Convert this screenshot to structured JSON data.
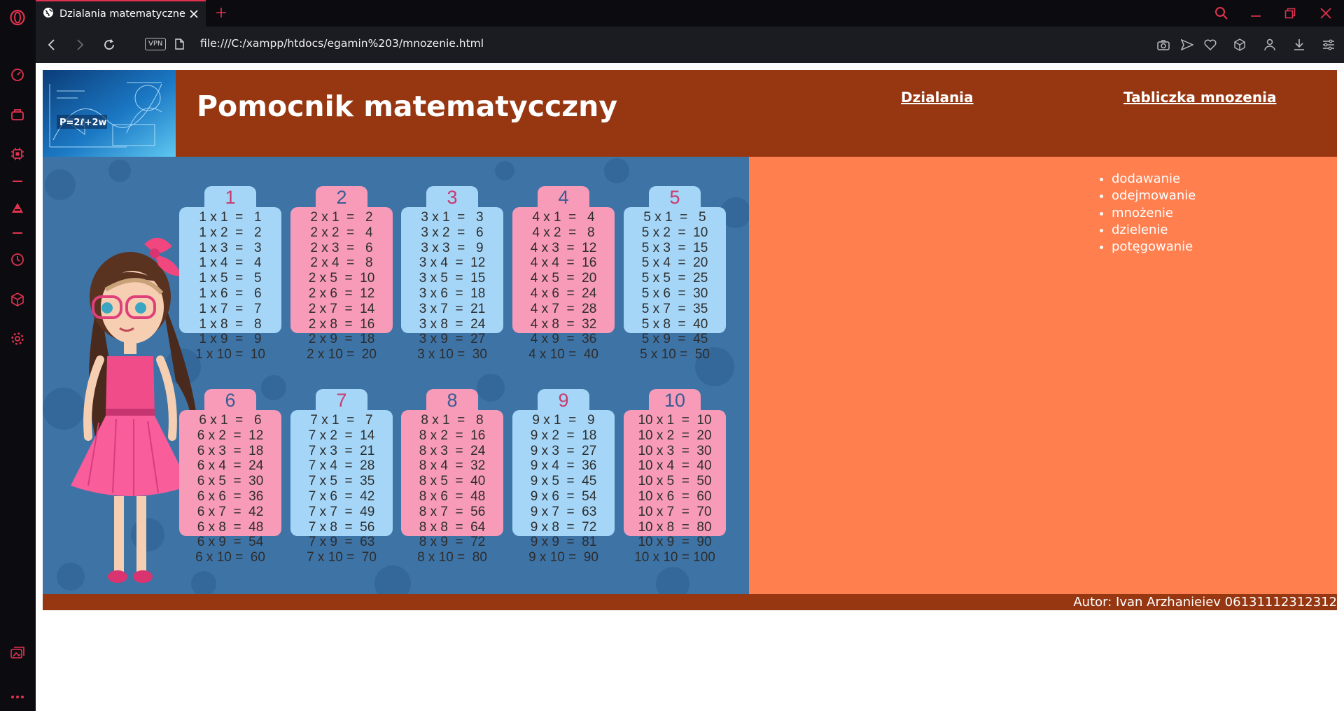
{
  "browser": {
    "tab_title": "Dzialania matematyczne",
    "vpn_label": "VPN",
    "url": "file:///C:/xampp/htdocs/egamin%203/mnozenie.html",
    "accent_color": "#e2324f"
  },
  "page": {
    "title": "Pomocnik matematycczny",
    "nav": {
      "link1": "Dzialania",
      "link2": "Tabliczka mnozenia"
    },
    "operations": [
      "dodawanie",
      "odejmowanie",
      "mnożenie",
      "dzielenie",
      "potęgowanie"
    ],
    "footer": "Autor: Ivan Arzhanieiev 06131112312312",
    "colors": {
      "header": "#963712",
      "panel": "#ff7f4f",
      "image_bg": "#3e73a6",
      "card_blue": "#a5d6f7",
      "card_pink": "#f79bb8"
    },
    "logo_text": "P=2ℓ+2w"
  },
  "tables": [
    {
      "number": "1",
      "rows": [
        "1 x 1  =   1",
        "1 x 2  =   2",
        "1 x 3  =   3",
        "1 x 4  =   4",
        "1 x 5  =   5",
        "1 x 6  =   6",
        "1 x 7  =   7",
        "1 x 8  =   8",
        "1 x 9  =   9",
        "1 x 10 =  10"
      ]
    },
    {
      "number": "2",
      "rows": [
        "2 x 1  =   2",
        "2 x 2  =   4",
        "2 x 3  =   6",
        "2 x 4  =   8",
        "2 x 5  =  10",
        "2 x 6  =  12",
        "2 x 7  =  14",
        "2 x 8  =  16",
        "2 x 9  =  18",
        "2 x 10 =  20"
      ]
    },
    {
      "number": "3",
      "rows": [
        "3 x 1  =   3",
        "3 x 2  =   6",
        "3 x 3  =   9",
        "3 x 4  =  12",
        "3 x 5  =  15",
        "3 x 6  =  18",
        "3 x 7  =  21",
        "3 x 8  =  24",
        "3 x 9  =  27",
        "3 x 10 =  30"
      ]
    },
    {
      "number": "4",
      "rows": [
        "4 x 1  =   4",
        "4 x 2  =   8",
        "4 x 3  =  12",
        "4 x 4  =  16",
        "4 x 5  =  20",
        "4 x 6  =  24",
        "4 x 7  =  28",
        "4 x 8  =  32",
        "4 x 9  =  36",
        "4 x 10 =  40"
      ]
    },
    {
      "number": "5",
      "rows": [
        "5 x 1  =   5",
        "5 x 2  =  10",
        "5 x 3  =  15",
        "5 x 4  =  20",
        "5 x 5  =  25",
        "5 x 6  =  30",
        "5 x 7  =  35",
        "5 x 8  =  40",
        "5 x 9  =  45",
        "5 x 10 =  50"
      ]
    },
    {
      "number": "6",
      "rows": [
        "6 x 1  =   6",
        "6 x 2  =  12",
        "6 x 3  =  18",
        "6 x 4  =  24",
        "6 x 5  =  30",
        "6 x 6  =  36",
        "6 x 7  =  42",
        "6 x 8  =  48",
        "6 x 9  =  54",
        "6 x 10 =  60"
      ]
    },
    {
      "number": "7",
      "rows": [
        "7 x 1  =   7",
        "7 x 2  =  14",
        "7 x 3  =  21",
        "7 x 4  =  28",
        "7 x 5  =  35",
        "7 x 6  =  42",
        "7 x 7  =  49",
        "7 x 8  =  56",
        "7 x 9  =  63",
        "7 x 10 =  70"
      ]
    },
    {
      "number": "8",
      "rows": [
        "8 x 1  =   8",
        "8 x 2  =  16",
        "8 x 3  =  24",
        "8 x 4  =  32",
        "8 x 5  =  40",
        "8 x 6  =  48",
        "8 x 7  =  56",
        "8 x 8  =  64",
        "8 x 9  =  72",
        "8 x 10 =  80"
      ]
    },
    {
      "number": "9",
      "rows": [
        "9 x 1  =   9",
        "9 x 2  =  18",
        "9 x 3  =  27",
        "9 x 4  =  36",
        "9 x 5  =  45",
        "9 x 6  =  54",
        "9 x 7  =  63",
        "9 x 8  =  72",
        "9 x 9  =  81",
        "9 x 10 =  90"
      ]
    },
    {
      "number": "10",
      "rows": [
        "10 x 1  =  10",
        "10 x 2  =  20",
        "10 x 3  =  30",
        "10 x 4  =  40",
        "10 x 5  =  50",
        "10 x 6  =  60",
        "10 x 7  =  70",
        "10 x 8  =  80",
        "10 x 9  =  90",
        "10 x 10 = 100"
      ]
    }
  ]
}
